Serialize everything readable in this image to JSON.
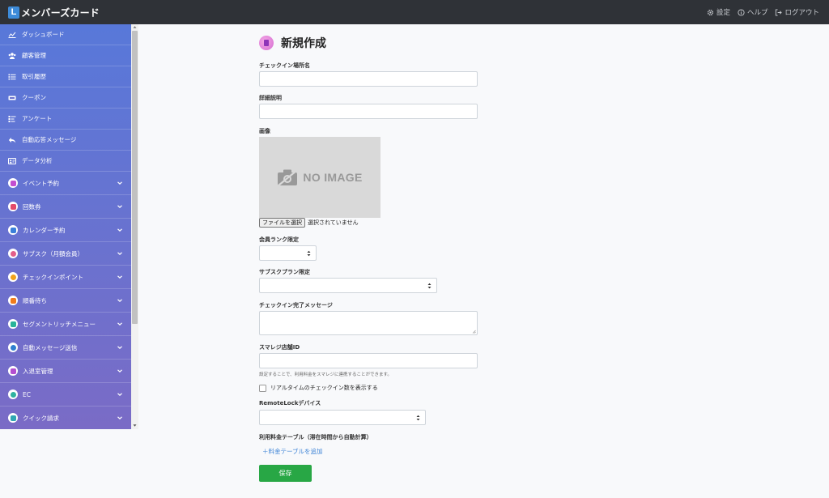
{
  "header": {
    "logo_letter": "L",
    "app_title": "メンバーズカード",
    "actions": [
      {
        "label": "設定",
        "icon": "gear-icon"
      },
      {
        "label": "ヘルプ",
        "icon": "info-icon"
      },
      {
        "label": "ログアウト",
        "icon": "logout-icon"
      }
    ]
  },
  "sidebar": {
    "simple_items": [
      {
        "label": "ダッシュボード",
        "icon": "chart-line-icon"
      },
      {
        "label": "顧客管理",
        "icon": "users-icon"
      },
      {
        "label": "取引履歴",
        "icon": "list-icon"
      },
      {
        "label": "クーポン",
        "icon": "ticket-icon"
      },
      {
        "label": "アンケート",
        "icon": "survey-icon"
      },
      {
        "label": "自動応答メッセージ",
        "icon": "reply-icon"
      },
      {
        "label": "データ分析",
        "icon": "analytics-icon"
      }
    ],
    "group_items": [
      {
        "label": "イベント予約",
        "color": "#c34fd0"
      },
      {
        "label": "回数券",
        "color": "#e34a6a"
      },
      {
        "label": "カレンダー予約",
        "color": "#3b7fd9"
      },
      {
        "label": "サブスク（月額会員）",
        "color": "#e35f8a"
      },
      {
        "label": "チェックインポイント",
        "color": "#f0a21c"
      },
      {
        "label": "順番待ち",
        "color": "#f07b1c"
      },
      {
        "label": "セグメントリッチメニュー",
        "color": "#29b39a"
      },
      {
        "label": "自動メッセージ送信",
        "color": "#2f7fd0"
      },
      {
        "label": "入退室管理",
        "color": "#b34fd0"
      },
      {
        "label": "EC",
        "color": "#2fb3a0"
      },
      {
        "label": "クイック請求",
        "color": "#2fa6b3"
      }
    ]
  },
  "form": {
    "title": "新規作成",
    "checkin_place_label": "チェックイン場所名",
    "checkin_place_value": "",
    "description_label": "詳細説明",
    "description_value": "",
    "image_label": "画像",
    "no_image_text": "NO IMAGE",
    "file_button_label": "ファイルを選択",
    "file_status": "選択されていません",
    "member_rank_label": "会員ランク限定",
    "member_rank_value": "",
    "subscription_plan_label": "サブスクプラン限定",
    "subscription_plan_value": "",
    "checkin_message_label": "チェックイン完了メッセージ",
    "checkin_message_value": "",
    "smaregi_label": "スマレジ店舗ID",
    "smaregi_value": "",
    "smaregi_help": "設定することで、利用料金をスマレジに連携することができます。",
    "realtime_checkbox_label": "リアルタイムのチェックイン数を表示する",
    "remotelock_label": "RemoteLockデバイス",
    "remotelock_value": "",
    "fee_table_label": "利用料金テーブル（滞在時間から自動計算）",
    "add_fee_table_link": "＋料金テーブルを追加",
    "save_button": "保存"
  }
}
